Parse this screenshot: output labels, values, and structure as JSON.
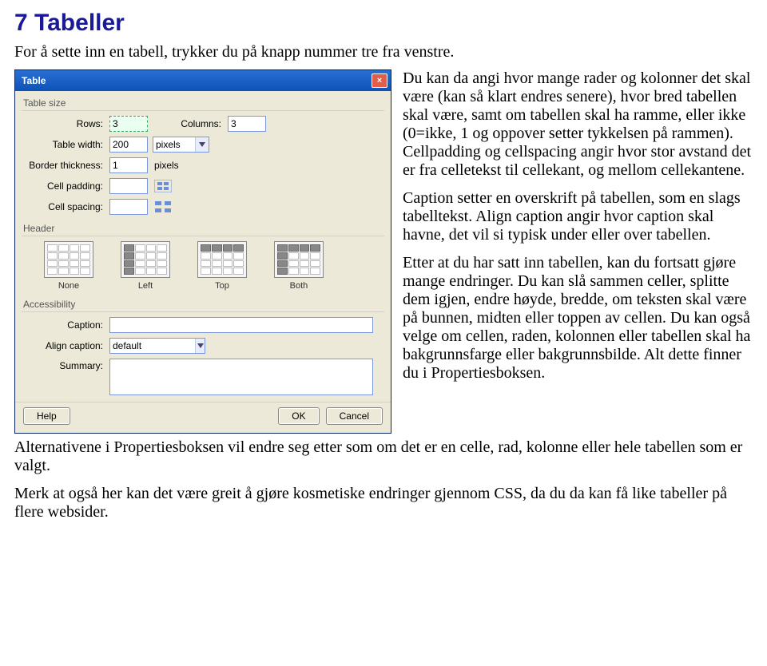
{
  "heading": "7 Tabeller",
  "intro": "For å sette inn en tabell, trykker du på knapp nummer tre fra venstre.",
  "dialog": {
    "title": "Table",
    "close": "×",
    "groups": {
      "size": {
        "label": "Table size",
        "rows_label": "Rows:",
        "rows_value": "3",
        "cols_label": "Columns:",
        "cols_value": "3",
        "width_label": "Table width:",
        "width_value": "200",
        "width_unit": "pixels",
        "border_label": "Border thickness:",
        "border_value": "1",
        "border_unit": "pixels",
        "padding_label": "Cell padding:",
        "padding_value": "",
        "spacing_label": "Cell spacing:",
        "spacing_value": ""
      },
      "header": {
        "label": "Header",
        "options": [
          "None",
          "Left",
          "Top",
          "Both"
        ]
      },
      "access": {
        "label": "Accessibility",
        "caption_label": "Caption:",
        "caption_value": "",
        "align_label": "Align caption:",
        "align_value": "default",
        "summary_label": "Summary:",
        "summary_value": ""
      }
    },
    "buttons": {
      "help": "Help",
      "ok": "OK",
      "cancel": "Cancel"
    }
  },
  "paras": {
    "p1": "Du kan da angi hvor mange rader og kolonner det skal være (kan så klart endres senere), hvor bred tabellen skal være, samt om tabellen skal ha ramme, eller ikke (0=ikke, 1 og oppover setter tykkelsen på rammen). Cellpadding og cellspacing angir hvor stor avstand det er fra celletekst til cellekant, og mellom cellekantene.",
    "p2": "Caption setter en overskrift på tabellen, som en slags tabelltekst. Align caption angir hvor caption skal havne, det vil si typisk under eller over tabellen.",
    "p3a": "Etter at du har satt inn tabellen, kan du fortsatt gjøre mange endringer. Du kan slå sammen celler, splitte dem igjen, endre høyde, bredde, om teksten skal være på bunnen, midten eller toppen av cellen. Du ",
    "p3b": "kan også velge om cellen, raden, kolonnen eller tabellen skal ha bakgrunnsfarge eller bakgrunnsbilde. Alt dette finner du i Propertiesboksen.",
    "p4": "Alternativene i Propertiesboksen vil endre seg etter som om det er en celle, rad, kolonne eller hele tabellen som er valgt.",
    "p5": "Merk at også her kan det være greit å gjøre kosmetiske endringer gjennom CSS, da du da kan få like tabeller på flere websider."
  }
}
